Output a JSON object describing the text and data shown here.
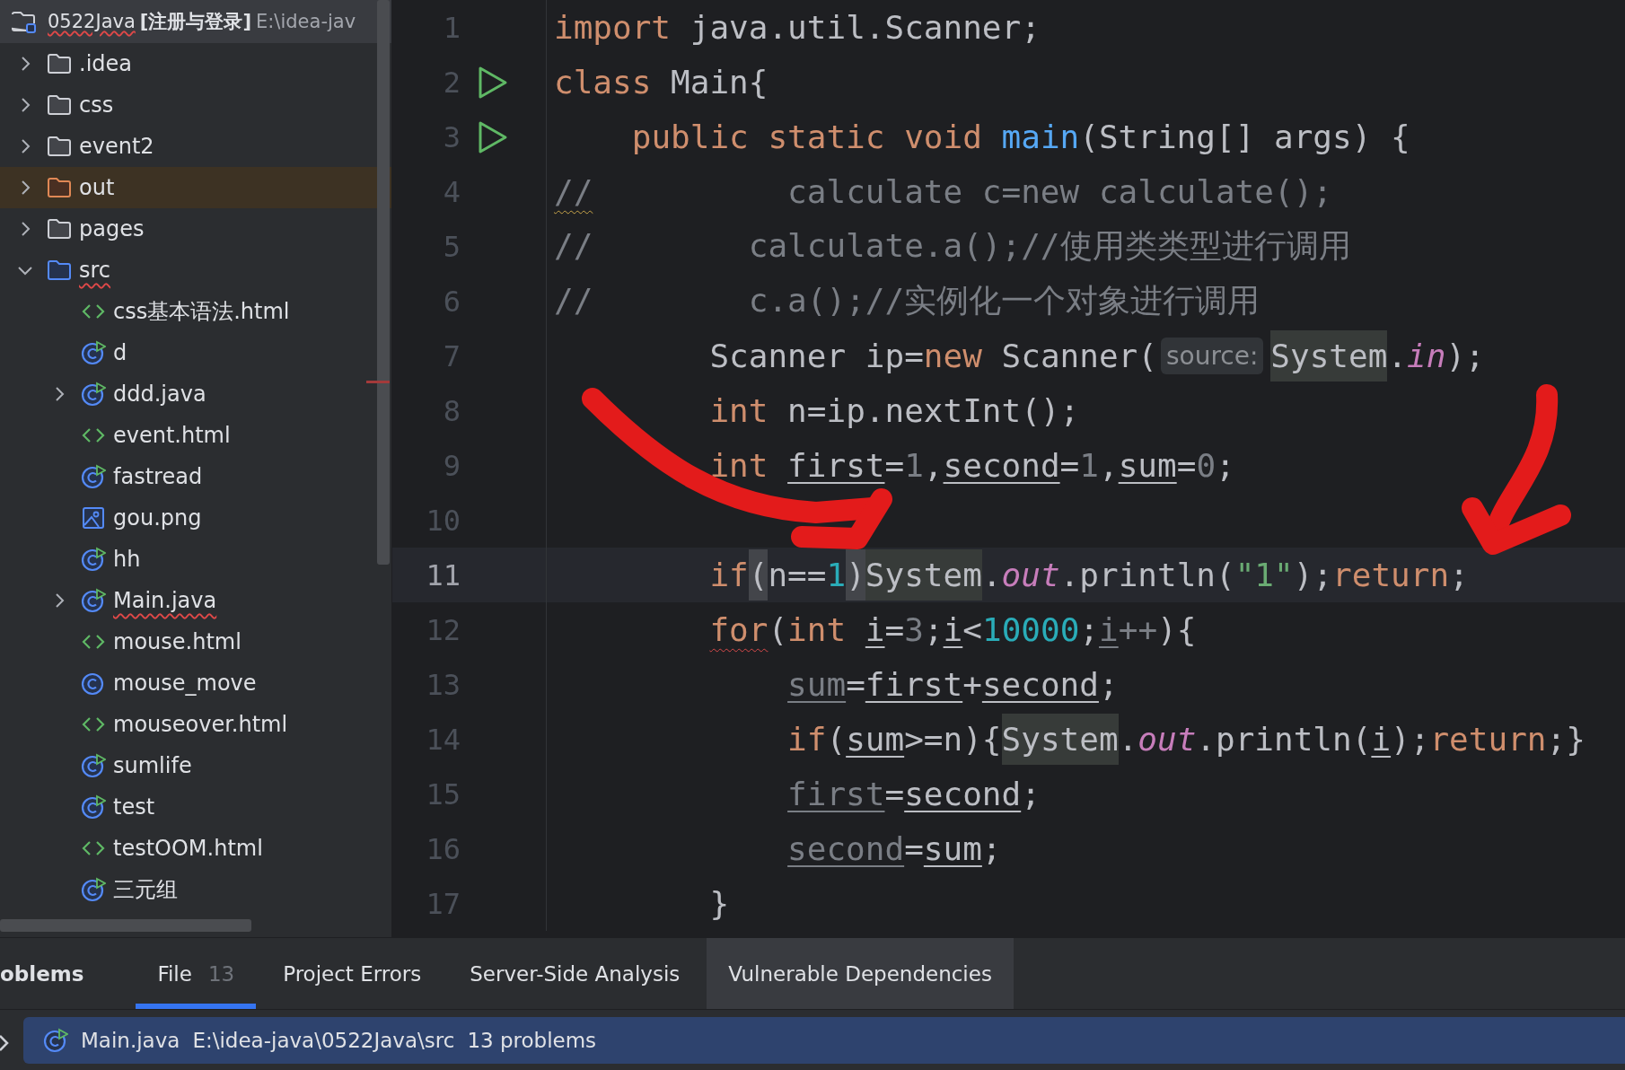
{
  "project_view": {
    "header": {
      "name": "0522Java",
      "module": "[注册与登录]",
      "path": "E:\\idea-jav",
      "error": true
    },
    "items": [
      {
        "label": ".idea",
        "kind": "folder",
        "expanded": false
      },
      {
        "label": "css",
        "kind": "folder",
        "expanded": false
      },
      {
        "label": "event2",
        "kind": "folder",
        "expanded": false
      },
      {
        "label": "out",
        "kind": "folder",
        "expanded": false,
        "excluded": true
      },
      {
        "label": "pages",
        "kind": "folder",
        "expanded": false
      },
      {
        "label": "src",
        "kind": "folder",
        "expanded": true,
        "error": true,
        "source": true,
        "children": [
          {
            "label": "css基本语法.html",
            "kind": "html"
          },
          {
            "label": "d",
            "kind": "runnable-class"
          },
          {
            "label": "ddd.java",
            "kind": "runnable-class",
            "expanded": false
          },
          {
            "label": "event.html",
            "kind": "html"
          },
          {
            "label": "fastread",
            "kind": "runnable-class"
          },
          {
            "label": "gou.png",
            "kind": "image"
          },
          {
            "label": "hh",
            "kind": "runnable-class"
          },
          {
            "label": "Main.java",
            "kind": "runnable-class",
            "expanded": false,
            "error": true
          },
          {
            "label": "mouse.html",
            "kind": "html"
          },
          {
            "label": "mouse_move",
            "kind": "class"
          },
          {
            "label": "mouseover.html",
            "kind": "html"
          },
          {
            "label": "sumlife",
            "kind": "runnable-class"
          },
          {
            "label": "test",
            "kind": "runnable-class"
          },
          {
            "label": "testOOM.html",
            "kind": "html"
          },
          {
            "label": "三元组",
            "kind": "runnable-class"
          }
        ]
      }
    ]
  },
  "editor": {
    "lines": [
      {
        "number": "1",
        "current": false,
        "tokens": [
          {
            "kind": "kw",
            "text": "import"
          },
          {
            "kind": "plain",
            "text": " java.util.Scanner;"
          }
        ]
      },
      {
        "number": "2",
        "current": false,
        "run": true,
        "tokens": [
          {
            "kind": "kw",
            "text": "class"
          },
          {
            "kind": "plain",
            "text": " Main{"
          }
        ]
      },
      {
        "number": "3",
        "current": false,
        "run": true,
        "tokens": [
          {
            "kind": "kw",
            "text": "    public static void "
          },
          {
            "kind": "fn",
            "text": "main"
          },
          {
            "kind": "plain",
            "text": "(String[] args) {"
          }
        ]
      },
      {
        "number": "4",
        "current": false,
        "tokens": [
          {
            "kind": "cmt",
            "text": "//",
            "warning": true
          },
          {
            "kind": "cmt",
            "text": "          calculate c=new calculate();"
          }
        ]
      },
      {
        "number": "5",
        "current": false,
        "tokens": [
          {
            "kind": "cmt",
            "text": "//        calculate.a();//使用类类型进行调用"
          }
        ]
      },
      {
        "number": "6",
        "current": false,
        "tokens": [
          {
            "kind": "cmt",
            "text": "//        c.a();//实例化一个对象进行调用"
          }
        ]
      },
      {
        "number": "7",
        "current": false,
        "tokens": [
          {
            "kind": "plain",
            "text": "        Scanner ip="
          },
          {
            "kind": "kw",
            "text": "new"
          },
          {
            "kind": "plain",
            "text": " Scanner("
          },
          {
            "kind": "hint",
            "text": "source:"
          },
          {
            "kind": "plain",
            "text": "System",
            "hl": true
          },
          {
            "kind": "plain",
            "text": "."
          },
          {
            "kind": "field",
            "text": "in"
          },
          {
            "kind": "plain",
            "text": ");"
          }
        ]
      },
      {
        "number": "8",
        "current": false,
        "tokens": [
          {
            "kind": "kw",
            "text": "        int"
          },
          {
            "kind": "plain",
            "text": " n=ip.nextInt();"
          }
        ]
      },
      {
        "number": "9",
        "current": false,
        "tokens": [
          {
            "kind": "kw",
            "text": "        int "
          },
          {
            "kind": "var",
            "text": "first"
          },
          {
            "kind": "plain",
            "text": "="
          },
          {
            "kind": "dim",
            "text": "1"
          },
          {
            "kind": "plain",
            "text": ","
          },
          {
            "kind": "var",
            "text": "second"
          },
          {
            "kind": "plain",
            "text": "="
          },
          {
            "kind": "dim",
            "text": "1"
          },
          {
            "kind": "plain",
            "text": ","
          },
          {
            "kind": "var",
            "text": "sum"
          },
          {
            "kind": "plain",
            "text": "="
          },
          {
            "kind": "dim",
            "text": "0"
          },
          {
            "kind": "plain",
            "text": ";"
          }
        ]
      },
      {
        "number": "10",
        "current": false
      },
      {
        "number": "11",
        "current": true,
        "tokens": [
          {
            "kind": "kw",
            "text": "        if"
          },
          {
            "kind": "plain",
            "text": "(",
            "bracket": true
          },
          {
            "kind": "plain",
            "text": "n=="
          },
          {
            "kind": "num",
            "text": "1"
          },
          {
            "kind": "plain",
            "text": ")",
            "bracket": true
          },
          {
            "kind": "plain",
            "text": "System",
            "hl": true
          },
          {
            "kind": "plain",
            "text": "."
          },
          {
            "kind": "field",
            "text": "out"
          },
          {
            "kind": "plain",
            "text": ".println("
          },
          {
            "kind": "str",
            "text": "\"1\""
          },
          {
            "kind": "plain",
            "text": ");"
          },
          {
            "kind": "kw",
            "text": "return"
          },
          {
            "kind": "plain",
            "text": ";"
          }
        ]
      },
      {
        "number": "12",
        "current": false,
        "tokens": [
          {
            "kind": "kw",
            "text": "        for",
            "error": true
          },
          {
            "kind": "plain",
            "text": "("
          },
          {
            "kind": "kw",
            "text": "int "
          },
          {
            "kind": "var",
            "text": "i"
          },
          {
            "kind": "plain",
            "text": "="
          },
          {
            "kind": "dim",
            "text": "3"
          },
          {
            "kind": "plain",
            "text": ";"
          },
          {
            "kind": "var",
            "text": "i"
          },
          {
            "kind": "plain",
            "text": "<"
          },
          {
            "kind": "num",
            "text": "10000"
          },
          {
            "kind": "plain",
            "text": ";"
          },
          {
            "kind": "unused",
            "text": "i"
          },
          {
            "kind": "dim",
            "text": "++"
          },
          {
            "kind": "plain",
            "text": "){"
          }
        ]
      },
      {
        "number": "13",
        "current": false,
        "tokens": [
          {
            "kind": "unused",
            "text": "            sum"
          },
          {
            "kind": "plain",
            "text": "="
          },
          {
            "kind": "var",
            "text": "first"
          },
          {
            "kind": "plain",
            "text": "+"
          },
          {
            "kind": "var",
            "text": "second"
          },
          {
            "kind": "plain",
            "text": ";"
          }
        ]
      },
      {
        "number": "14",
        "current": false,
        "tokens": [
          {
            "kind": "kw",
            "text": "            if"
          },
          {
            "kind": "plain",
            "text": "("
          },
          {
            "kind": "var",
            "text": "sum"
          },
          {
            "kind": "plain",
            "text": ">=n){"
          },
          {
            "kind": "plain",
            "text": "System",
            "hl": true
          },
          {
            "kind": "plain",
            "text": "."
          },
          {
            "kind": "field",
            "text": "out"
          },
          {
            "kind": "plain",
            "text": ".println("
          },
          {
            "kind": "var",
            "text": "i"
          },
          {
            "kind": "plain",
            "text": ");"
          },
          {
            "kind": "kw",
            "text": "return"
          },
          {
            "kind": "plain",
            "text": ";}"
          }
        ]
      },
      {
        "number": "15",
        "current": false,
        "tokens": [
          {
            "kind": "unused",
            "text": "            first"
          },
          {
            "kind": "plain",
            "text": "="
          },
          {
            "kind": "var",
            "text": "second"
          },
          {
            "kind": "plain",
            "text": ";"
          }
        ]
      },
      {
        "number": "16",
        "current": false,
        "tokens": [
          {
            "kind": "unused",
            "text": "            second"
          },
          {
            "kind": "plain",
            "text": "="
          },
          {
            "kind": "var",
            "text": "sum"
          },
          {
            "kind": "plain",
            "text": ";"
          }
        ]
      },
      {
        "number": "17",
        "current": false,
        "tokens": [
          {
            "kind": "plain",
            "text": "        }"
          }
        ]
      }
    ]
  },
  "problems_panel": {
    "title": "oblems",
    "tabs": [
      {
        "label": "File",
        "count": "13",
        "selected": true,
        "hovered": false
      },
      {
        "label": "Project Errors",
        "selected": false,
        "hovered": false
      },
      {
        "label": "Server-Side Analysis",
        "selected": false,
        "hovered": false
      },
      {
        "label": "Vulnerable Dependencies",
        "selected": false,
        "hovered": true
      }
    ],
    "rows": [
      {
        "file": "Main.java",
        "path": "E:\\idea-java\\0522Java\\src",
        "count": "13 problems",
        "selected": true
      }
    ]
  }
}
